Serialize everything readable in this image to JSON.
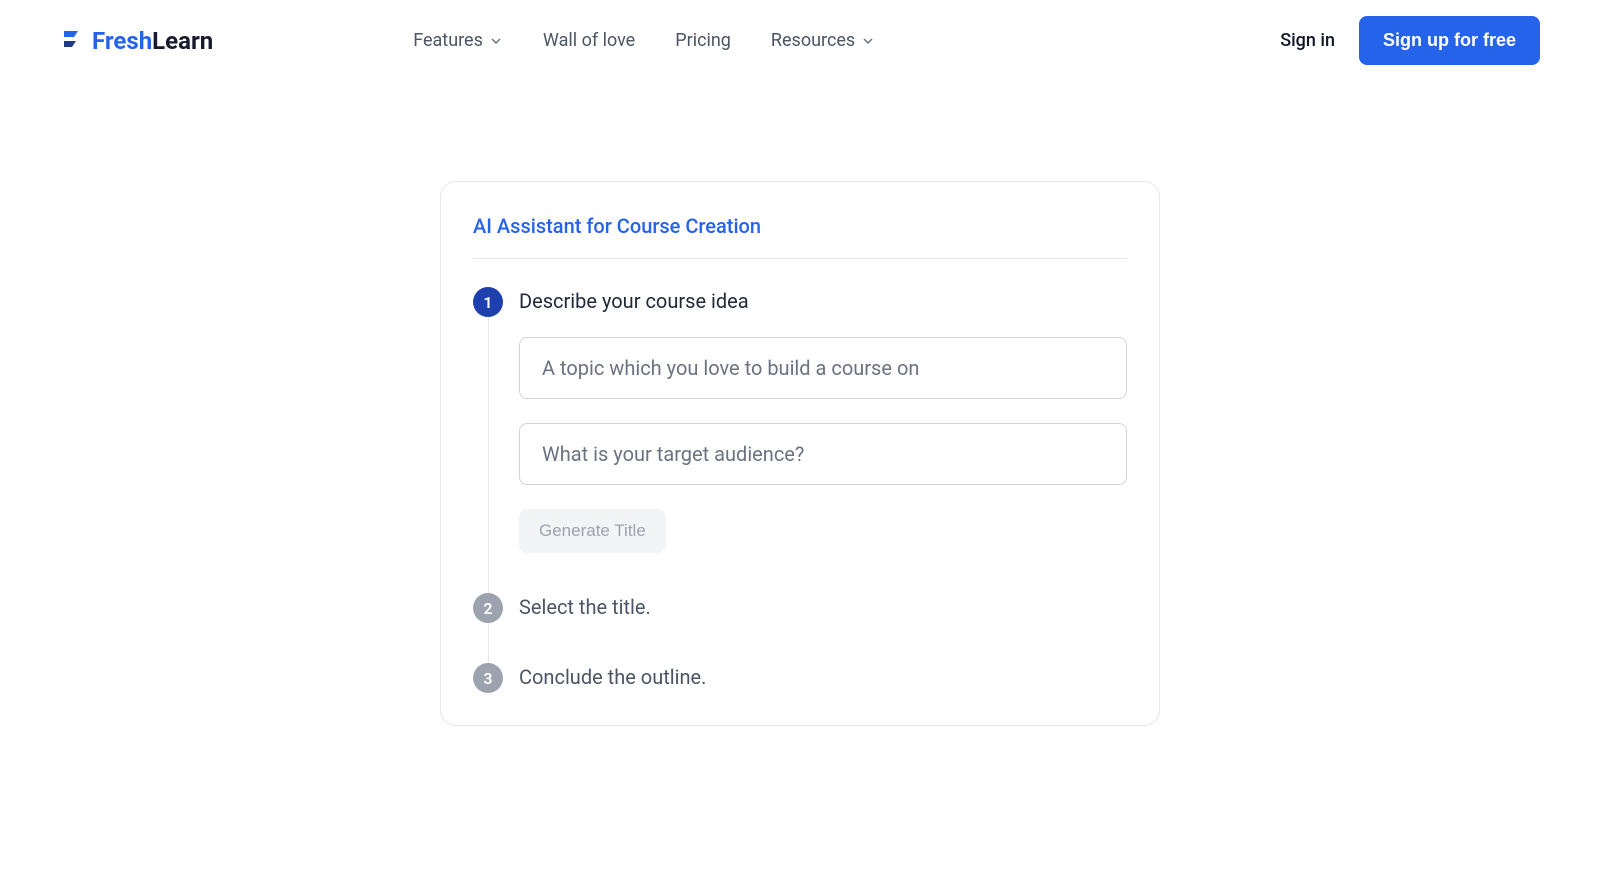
{
  "logo": {
    "fresh": "Fresh",
    "learn": "Learn"
  },
  "nav": {
    "features": "Features",
    "wall": "Wall of love",
    "pricing": "Pricing",
    "resources": "Resources"
  },
  "auth": {
    "signin": "Sign in",
    "signup": "Sign up for free"
  },
  "card": {
    "title": "AI Assistant for Course Creation",
    "step1": {
      "num": "1",
      "title": "Describe your course idea",
      "topic_placeholder": "A topic which you love to build a course on",
      "audience_placeholder": "What is your target audience?",
      "button": "Generate Title"
    },
    "step2": {
      "num": "2",
      "title": "Select the title."
    },
    "step3": {
      "num": "3",
      "title": "Conclude the outline."
    }
  }
}
